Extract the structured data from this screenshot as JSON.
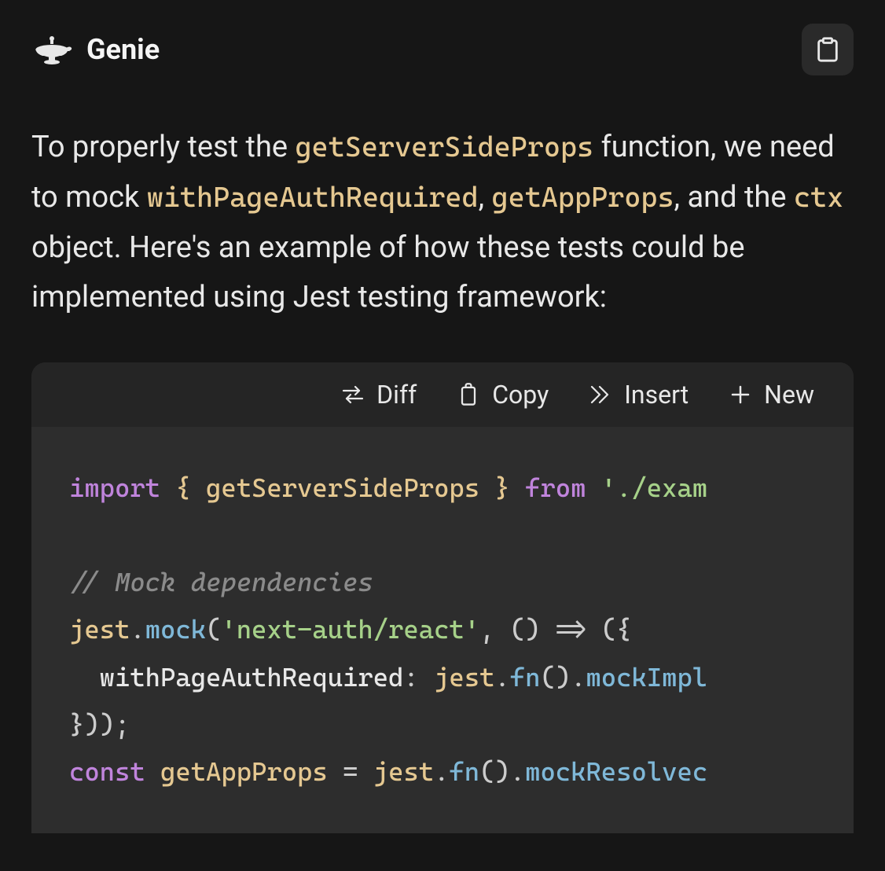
{
  "header": {
    "title": "Genie"
  },
  "body": {
    "text1": "To properly test the ",
    "code1": "getServerSideProps",
    "text2": " function, we need to mock ",
    "code2": "withPageAuthRequired",
    "text3": ", ",
    "code3": "getAppProps",
    "text4": ", and the ",
    "code4": "ctx",
    "text5": " object. Here's an example of how these tests could be implemented using Jest testing framework:"
  },
  "toolbar": {
    "diff": "Diff",
    "copy": "Copy",
    "insert": "Insert",
    "new": "New"
  },
  "code": {
    "line1_import": "import",
    "line1_brace_open": " { ",
    "line1_ident": "getServerSideProps",
    "line1_brace_close": " } ",
    "line1_from": "from",
    "line1_sp": " ",
    "line1_string": "'./exam",
    "line2": "",
    "line3_comment": "// Mock dependencies",
    "line4_ident": "jest",
    "line4_dot": ".",
    "line4_method": "mock",
    "line4_paren_open": "(",
    "line4_string": "'next-auth/react'",
    "line4_comma": ", () ",
    "line4_arrow": "=>",
    "line4_tail": " ({",
    "line5_indent": "  ",
    "line5_prop": "withPageAuthRequired",
    "line5_colon": ": ",
    "line5_ident": "jest",
    "line5_dot": ".",
    "line5_method": "fn",
    "line5_parens": "().",
    "line5_method2": "mockImpl",
    "line6_close": "}));",
    "line7_const": "const",
    "line7_sp": " ",
    "line7_ident": "getAppProps",
    "line7_eq": " = ",
    "line7_jest": "jest",
    "line7_dot": ".",
    "line7_fn": "fn",
    "line7_parens": "().",
    "line7_method": "mockResolvec"
  }
}
